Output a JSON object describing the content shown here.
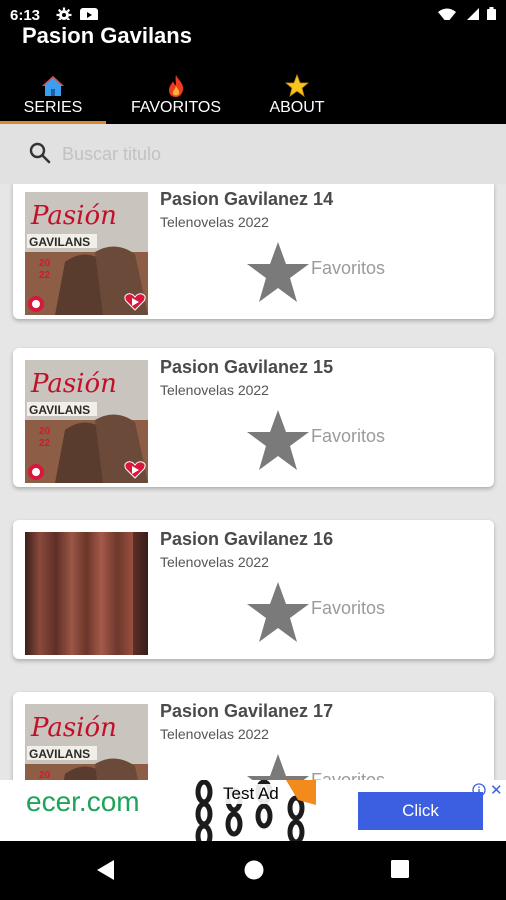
{
  "status": {
    "time": "6:13",
    "left_icons": [
      "gear-icon",
      "youtube-icon"
    ],
    "right_icons": [
      "wifi-icon",
      "signal-icon",
      "battery-icon"
    ]
  },
  "app": {
    "title": "Pasion Gavilans"
  },
  "tabs": [
    {
      "label": "SERIES",
      "icon": "home-icon",
      "selected": true
    },
    {
      "label": "FAVORITOS",
      "icon": "fire-icon",
      "selected": false
    },
    {
      "label": "ABOUT",
      "icon": "star-icon",
      "selected": false
    }
  ],
  "search": {
    "placeholder": "Buscar titulo",
    "value": ""
  },
  "items": [
    {
      "title": "Pasion Gavilanez 14",
      "subtitle": "Telenovelas 2022",
      "favorite_label": "Favoritos",
      "thumb": "poster"
    },
    {
      "title": "Pasion Gavilanez 15",
      "subtitle": "Telenovelas 2022",
      "favorite_label": "Favoritos",
      "thumb": "poster"
    },
    {
      "title": "Pasion Gavilanez 16",
      "subtitle": "Telenovelas 2022",
      "favorite_label": "Favoritos",
      "thumb": "curtain"
    },
    {
      "title": "Pasion Gavilanez 17",
      "subtitle": "Telenovelas 2022",
      "favorite_label": "Favoritos",
      "thumb": "poster"
    }
  ],
  "ad": {
    "brand": "ecer.com",
    "test_label": "Test Ad",
    "click_label": "Click"
  },
  "colors": {
    "accent": "#d9892b",
    "star": "#7a7a7a",
    "ad_button": "#3b5fe0",
    "ad_brand": "#1ea35a"
  }
}
